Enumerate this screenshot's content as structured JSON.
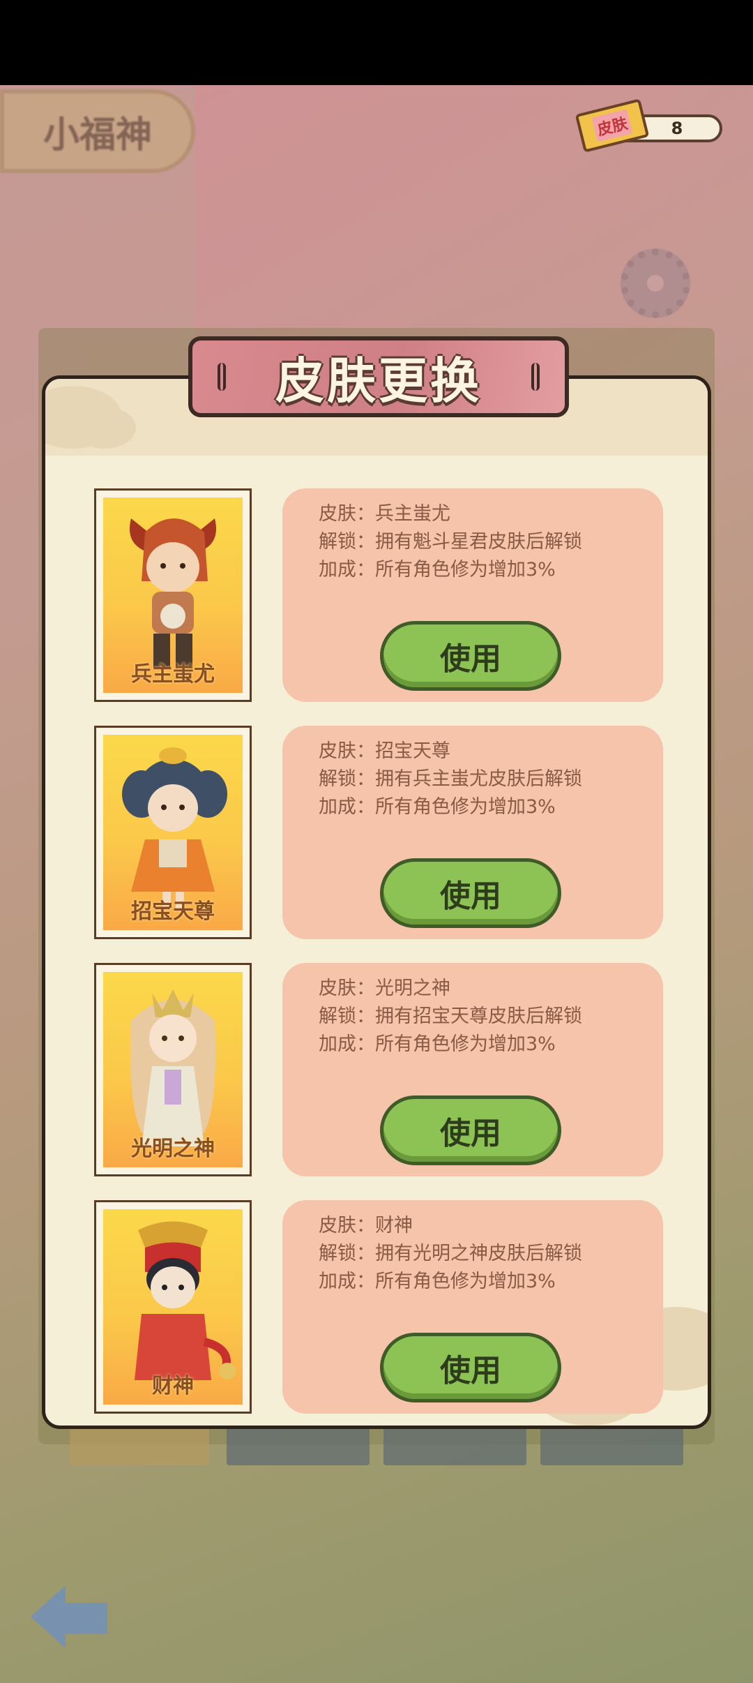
{
  "top_left_title": "小福神",
  "currency": {
    "label": "皮肤",
    "count": "8"
  },
  "dialog": {
    "title": "皮肤更换",
    "skins": [
      {
        "card_name": "兵主蚩尤",
        "skin": "皮肤：兵主蚩尤",
        "unlock": "解锁：拥有魁斗星君皮肤后解锁",
        "bonus": "加成：所有角色修为增加3%",
        "button": "使用"
      },
      {
        "card_name": "招宝天尊",
        "skin": "皮肤：招宝天尊",
        "unlock": "解锁：拥有兵主蚩尤皮肤后解锁",
        "bonus": "加成：所有角色修为增加3%",
        "button": "使用"
      },
      {
        "card_name": "光明之神",
        "skin": "皮肤：光明之神",
        "unlock": "解锁：拥有招宝天尊皮肤后解锁",
        "bonus": "加成：所有角色修为增加3%",
        "button": "使用"
      },
      {
        "card_name": "财神",
        "skin": "皮肤：财神",
        "unlock": "解锁：拥有光明之神皮肤后解锁",
        "bonus": "加成：所有角色修为增加3%",
        "button": "使用"
      }
    ]
  },
  "icons": {
    "back": "back-arrow-icon",
    "settings": "gear-icon",
    "ticket": "skin-ticket-icon"
  },
  "colors": {
    "panel": "#f6efd7",
    "info_box": "#f6c3ab",
    "button": "#8dc355",
    "banner": "#d88a8e"
  }
}
